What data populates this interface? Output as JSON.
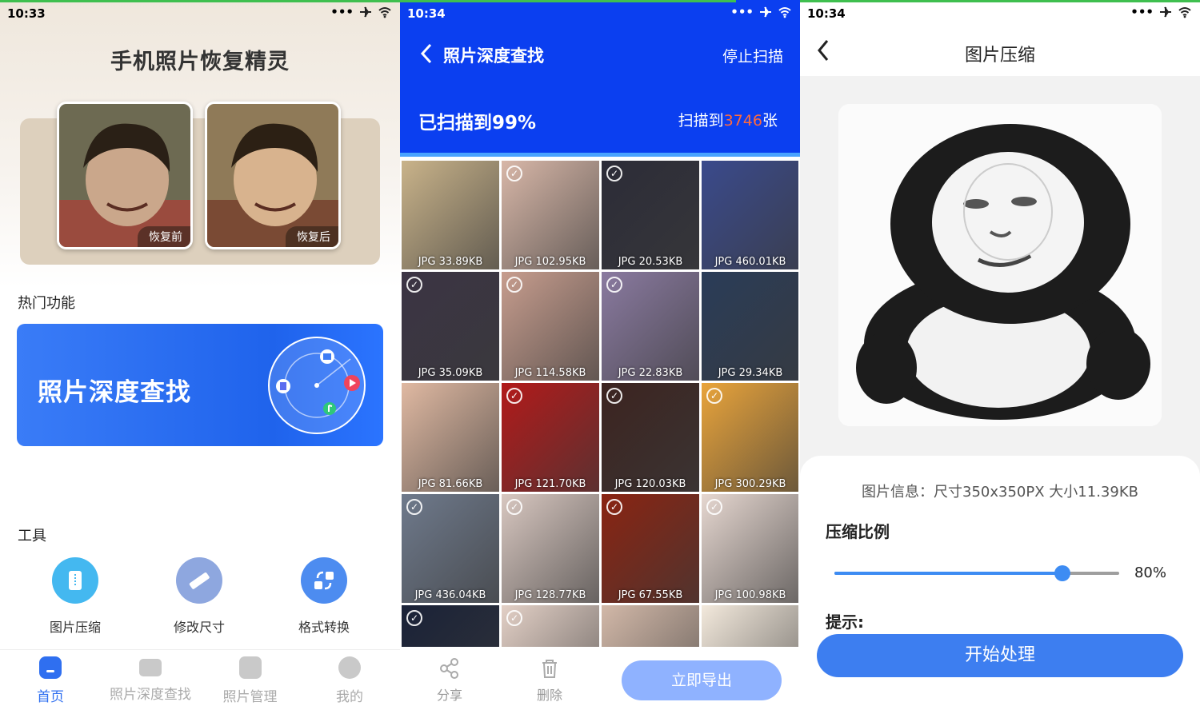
{
  "screen_home": {
    "time": "10:33",
    "title": "手机照片恢复精灵",
    "before_label": "恢复前",
    "after_label": "恢复后",
    "hot_section": "热门功能",
    "banner_text": "照片深度查找",
    "tools_section": "工具",
    "tools": [
      {
        "label": "图片压缩",
        "icon": "compress-icon",
        "color": "#44b8f0"
      },
      {
        "label": "修改尺寸",
        "icon": "ruler-icon",
        "color": "#8ea7df"
      },
      {
        "label": "格式转换",
        "icon": "convert-icon",
        "color": "#4d8cf0"
      }
    ],
    "nav": [
      {
        "label": "首页",
        "icon": "home-icon",
        "active": true
      },
      {
        "label": "照片深度查找",
        "icon": "briefcase-icon",
        "active": false
      },
      {
        "label": "照片管理",
        "icon": "image-icon",
        "active": false
      },
      {
        "label": "我的",
        "icon": "user-icon",
        "active": false
      }
    ],
    "accent": "#2f6ff0"
  },
  "screen_scan": {
    "time": "10:34",
    "title": "照片深度查找",
    "stop_label": "停止扫描",
    "progress_text": "已扫描到99%",
    "count_prefix": "扫描到",
    "count_value": "3746",
    "count_suffix": "张",
    "progress": 0.99,
    "photos": [
      {
        "meta": "JPG   33.89KB",
        "checked": false
      },
      {
        "meta": "JPG   102.95KB",
        "checked": true
      },
      {
        "meta": "JPG   20.53KB",
        "checked": true
      },
      {
        "meta": "JPG   460.01KB",
        "checked": false
      },
      {
        "meta": "JPG   35.09KB",
        "checked": true
      },
      {
        "meta": "JPG   114.58KB",
        "checked": true
      },
      {
        "meta": "JPG   22.83KB",
        "checked": true
      },
      {
        "meta": "JPG   29.34KB",
        "checked": false
      },
      {
        "meta": "JPG   81.66KB",
        "checked": false
      },
      {
        "meta": "JPG   121.70KB",
        "checked": true
      },
      {
        "meta": "JPG   120.03KB",
        "checked": true
      },
      {
        "meta": "JPG   300.29KB",
        "checked": true
      },
      {
        "meta": "JPG   436.04KB",
        "checked": true
      },
      {
        "meta": "JPG   128.77KB",
        "checked": true
      },
      {
        "meta": "JPG   67.55KB",
        "checked": true
      },
      {
        "meta": "JPG   100.98KB",
        "checked": true
      },
      {
        "meta": "",
        "checked": true
      },
      {
        "meta": "",
        "checked": true
      },
      {
        "meta": "",
        "checked": false
      },
      {
        "meta": "",
        "checked": false
      }
    ],
    "photo_colors": [
      "#c9b38a",
      "#d8b7a8",
      "#2c2c38",
      "#3a4a8c",
      "#3b3444",
      "#c79d8e",
      "#8a7aa0",
      "#2a3c58",
      "#e0b9a2",
      "#b21a1a",
      "#3c2420",
      "#e9a43b",
      "#6f7a8c",
      "#d8c7c0",
      "#8a2412",
      "#e6d7d0",
      "#1a2238",
      "#e3d0c6",
      "#d2b8a8",
      "#f3e9dc"
    ],
    "share_label": "分享",
    "delete_label": "删除",
    "export_label": "立即导出"
  },
  "screen_compress": {
    "time": "10:34",
    "title": "图片压缩",
    "info": "图片信息：尺寸350x350PX 大小11.39KB",
    "ratio_label": "压缩比例",
    "ratio_value": 0.8,
    "ratio_text": "80%",
    "tip_label": "提示:",
    "button_label": "开始处理"
  }
}
